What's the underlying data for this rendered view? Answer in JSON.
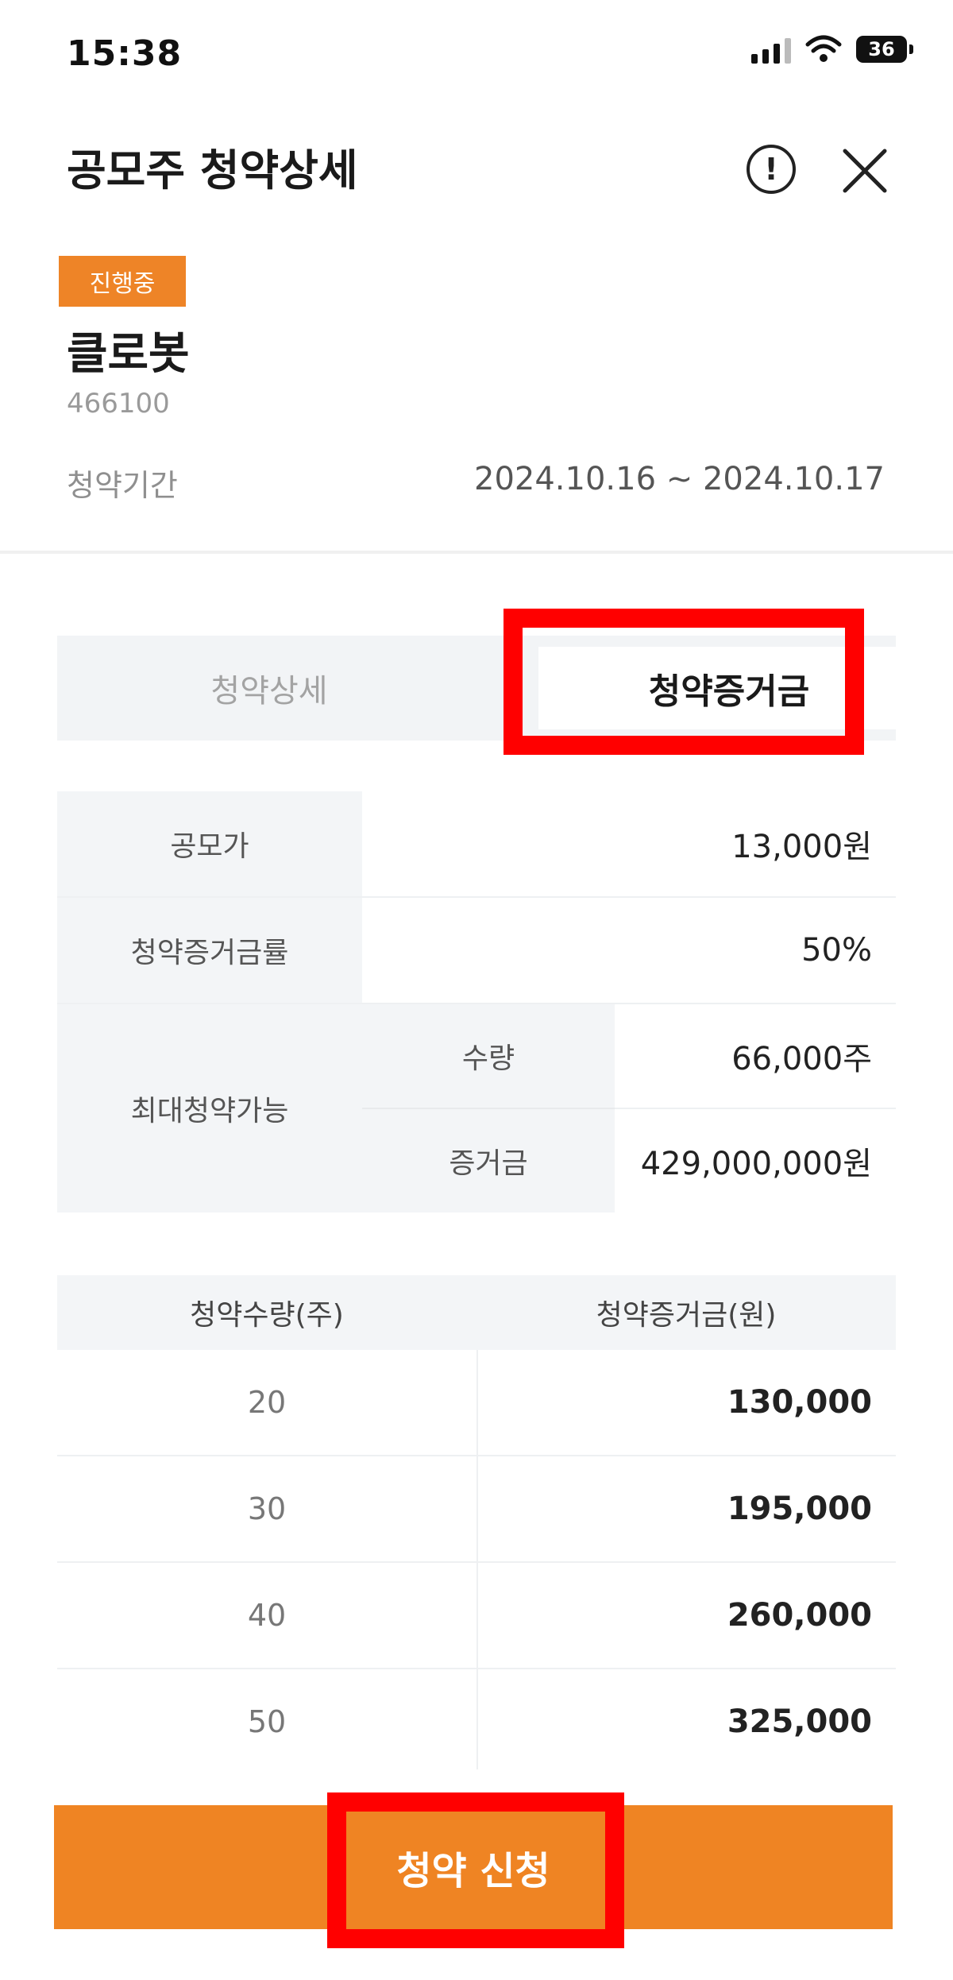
{
  "status_bar": {
    "time": "15:38",
    "battery": "36"
  },
  "header": {
    "title": "공모주 청약상세",
    "info_icon": "info-icon",
    "close_icon": "close-icon"
  },
  "stock": {
    "badge": "진행중",
    "name": "클로봇",
    "code": "466100",
    "period_label": "청약기간",
    "period_value": "2024.10.16 ~ 2024.10.17"
  },
  "tabs": {
    "detail": "청약상세",
    "deposit": "청약증거금"
  },
  "info_table": {
    "offer_price_label": "공모가",
    "offer_price_value": "13,000원",
    "deposit_rate_label": "청약증거금률",
    "deposit_rate_value": "50%",
    "max_label": "최대청약가능",
    "max_qty_label": "수량",
    "max_qty_value": "66,000주",
    "max_deposit_label": "증거금",
    "max_deposit_value": "429,000,000원"
  },
  "qty_table": {
    "headers": [
      "청약수량(주)",
      "청약증거금(원)"
    ],
    "rows": [
      {
        "qty": "20",
        "amount": "130,000"
      },
      {
        "qty": "30",
        "amount": "195,000"
      },
      {
        "qty": "40",
        "amount": "260,000"
      },
      {
        "qty": "50",
        "amount": "325,000"
      }
    ]
  },
  "apply_button": "청약 신청",
  "colors": {
    "accent": "#ef8423",
    "highlight": "#ff0000"
  }
}
